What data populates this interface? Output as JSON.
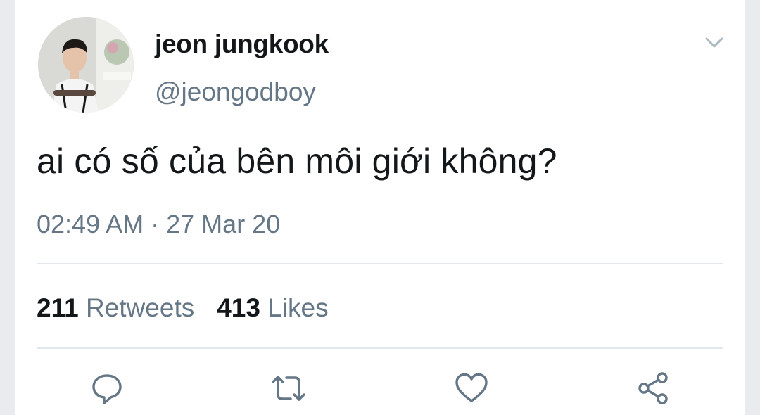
{
  "tweet": {
    "author_name": "jeon jungkook",
    "author_handle": "@jeongodboy",
    "text": "ai có số của bên môi giới không?",
    "time": "02:49 AM",
    "separator": "·",
    "date": "27 Mar 20",
    "retweets_count": "211",
    "retweets_label": "Retweets",
    "likes_count": "413",
    "likes_label": "Likes"
  },
  "icons": {
    "menu": "chevron-down-icon",
    "reply": "reply-icon",
    "retweet": "retweet-icon",
    "like": "heart-icon",
    "share": "share-icon"
  },
  "colors": {
    "primary_text": "#14171a",
    "secondary_text": "#657786",
    "divider": "#e1e8ed",
    "icon": "#657786"
  }
}
